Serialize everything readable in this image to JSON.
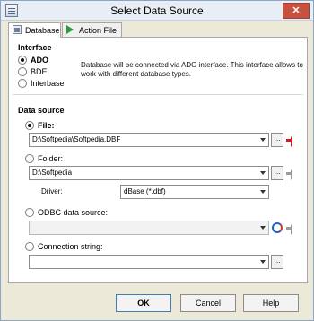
{
  "window": {
    "title": "Select Data Source",
    "close_label": "✕"
  },
  "tabs": [
    {
      "label": "Database",
      "active": true,
      "icon": "database-icon"
    },
    {
      "label": "Action File",
      "active": false,
      "icon": "play-icon"
    }
  ],
  "interface": {
    "title": "Interface",
    "options": [
      {
        "label": "ADO",
        "checked": true
      },
      {
        "label": "BDE",
        "checked": false
      },
      {
        "label": "Interbase",
        "checked": false
      }
    ],
    "description": "Database will be connected via ADO interface. This interface allows to work with different database types."
  },
  "data_source": {
    "title": "Data source",
    "file": {
      "label": "File:",
      "checked": true,
      "value": "D:\\Softpedia\\Softpedia.DBF",
      "browse_label": "..."
    },
    "folder": {
      "label": "Folder:",
      "checked": false,
      "value": "D:\\Softpedia",
      "browse_label": "...",
      "driver_label": "Driver:",
      "driver_value": "dBase (*.dbf)"
    },
    "odbc": {
      "label": "ODBC data source:",
      "checked": false,
      "value": ""
    },
    "connection": {
      "label": "Connection string:",
      "checked": false,
      "value": "",
      "browse_label": "..."
    }
  },
  "buttons": {
    "ok": "OK",
    "cancel": "Cancel",
    "help": "Help"
  }
}
